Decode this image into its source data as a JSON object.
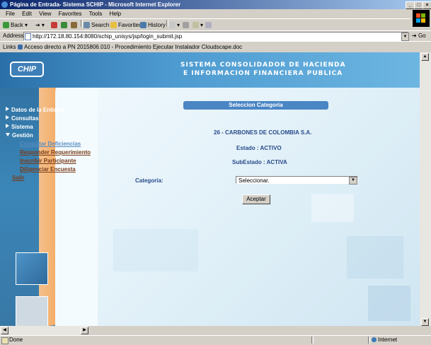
{
  "window": {
    "title": "Página de Entrada- Sistema SCHIP - Microsoft Internet Explorer"
  },
  "menu": [
    "File",
    "Edit",
    "View",
    "Favorites",
    "Tools",
    "Help"
  ],
  "toolbar": {
    "back": "Back",
    "search": "Search",
    "favorites": "Favorites",
    "history": "History"
  },
  "address": {
    "label": "Address",
    "url": "http://172.18.80.154:8080/schip_unisys/jsp/login_submit.jsp",
    "go": "Go"
  },
  "links": {
    "label": "Links",
    "item": "Acceso directo a PN 2015806.010 - Procedimiento Ejecutar Instalador Cloudscape.doc"
  },
  "header": {
    "logo": "CHIP",
    "line1": "SISTEMA CONSOLIDADOR DE HACIENDA",
    "line2": "E INFORMACION FINANCIERA PUBLICA"
  },
  "nav": {
    "items": [
      "Datos de la Entidad",
      "Consultas",
      "Sistema",
      "Gestión"
    ],
    "sub": [
      "Consultar Deficiencias",
      "Responder Requerimiento",
      "Inscribir Participante",
      "Diligenciar Encuesta"
    ],
    "salir": "Salir"
  },
  "form": {
    "heading": "Seleccion Categoria",
    "entity": "26 - CARBONES DE COLOMBIA S.A.",
    "estado": "Estado : ACTIVO",
    "subestado": "SubEstado : ACTIVA",
    "category_label": "Categoria:",
    "category_value": "Seleccionar.",
    "accept": "Aceptar"
  },
  "status": {
    "left": "Done",
    "zone": "Internet"
  },
  "colors": {
    "accent": "#4a85c4",
    "orange": "#f79a42",
    "title": "#0a246a"
  }
}
